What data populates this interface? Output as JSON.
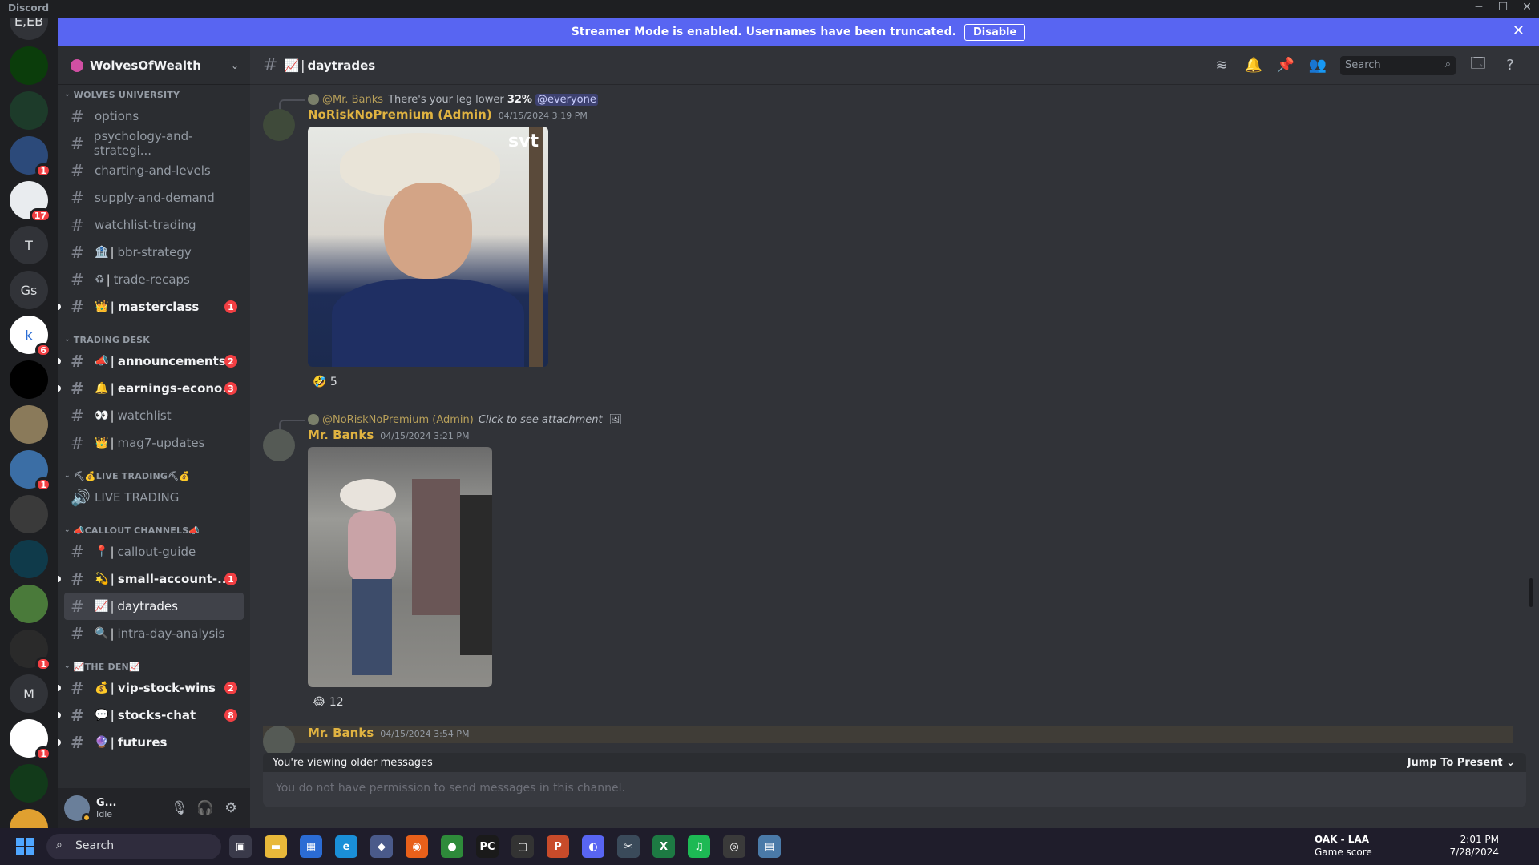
{
  "window": {
    "app_name": "Discord",
    "minimize": "─",
    "maximize": "☐",
    "close": "✕"
  },
  "banner": {
    "text": "Streamer Mode is enabled. Usernames have been truncated.",
    "button": "Disable",
    "close": "✕"
  },
  "servers": [
    {
      "label": "E,EB",
      "color": "#313338",
      "badge": ""
    },
    {
      "label": "",
      "color": "#0b3d0b",
      "badge": ""
    },
    {
      "label": "",
      "color": "#1d3b2a",
      "badge": ""
    },
    {
      "label": "",
      "color": "#2c4a7a",
      "badge": "1"
    },
    {
      "label": "",
      "color": "#e9ecef",
      "badge": "17"
    },
    {
      "label": "T",
      "color": "#313338",
      "badge": ""
    },
    {
      "label": "Gs",
      "color": "#313338",
      "badge": ""
    },
    {
      "label": "k",
      "color": "#ffffff",
      "badge": "6"
    },
    {
      "label": "",
      "color": "#000000",
      "badge": ""
    },
    {
      "label": "",
      "color": "#8a7a5a",
      "badge": ""
    },
    {
      "label": "",
      "color": "#3b6ea5",
      "badge": "1"
    },
    {
      "label": "",
      "color": "#3a3a3a",
      "badge": ""
    },
    {
      "label": "",
      "color": "#0f3a4a",
      "badge": ""
    },
    {
      "label": "",
      "color": "#4a7a3a",
      "badge": ""
    },
    {
      "label": "",
      "color": "#2a2a2a",
      "badge": "1"
    },
    {
      "label": "M",
      "color": "#313338",
      "badge": ""
    },
    {
      "label": "",
      "color": "#ffffff",
      "badge": "1"
    },
    {
      "label": "",
      "color": "#123a1a",
      "badge": ""
    },
    {
      "label": "",
      "color": "#e0a030",
      "badge": ""
    }
  ],
  "server_name": "WolvesOfWealth",
  "categories": [
    {
      "name": "WOLVES UNIVERSITY",
      "channels": [
        {
          "name": "options",
          "emoji": "",
          "unread": false,
          "mention": ""
        },
        {
          "name": "psychology-and-strategi...",
          "emoji": "",
          "unread": false,
          "mention": ""
        },
        {
          "name": "charting-and-levels",
          "emoji": "",
          "unread": false,
          "mention": ""
        },
        {
          "name": "supply-and-demand",
          "emoji": "",
          "unread": false,
          "mention": ""
        },
        {
          "name": "watchlist-trading",
          "emoji": "",
          "unread": false,
          "mention": ""
        },
        {
          "name": "bbr-strategy",
          "emoji": "🏦",
          "unread": false,
          "mention": ""
        },
        {
          "name": "trade-recaps",
          "emoji": "♻",
          "unread": false,
          "mention": ""
        },
        {
          "name": "masterclass",
          "emoji": "👑",
          "unread": true,
          "mention": "1"
        }
      ]
    },
    {
      "name": "TRADING DESK",
      "channels": [
        {
          "name": "announcements",
          "emoji": "📣",
          "unread": true,
          "mention": "2"
        },
        {
          "name": "earnings-econo...",
          "emoji": "🔔",
          "unread": true,
          "mention": "3"
        },
        {
          "name": "watchlist",
          "emoji": "👀",
          "unread": false,
          "mention": ""
        },
        {
          "name": "mag7-updates",
          "emoji": "👑",
          "unread": false,
          "mention": ""
        }
      ]
    },
    {
      "name": "⛏💰LIVE TRADING⛏💰",
      "channels": [
        {
          "name": "LIVE TRADING",
          "emoji": "",
          "unread": false,
          "mention": "",
          "voice": true
        }
      ]
    },
    {
      "name": "📣CALLOUT CHANNELS📣",
      "channels": [
        {
          "name": "callout-guide",
          "emoji": "📍",
          "unread": false,
          "mention": ""
        },
        {
          "name": "small-account-...",
          "emoji": "💫",
          "unread": true,
          "mention": "1"
        },
        {
          "name": "daytrades",
          "emoji": "📈",
          "unread": false,
          "mention": "",
          "selected": true
        },
        {
          "name": "intra-day-analysis",
          "emoji": "🔍",
          "unread": false,
          "mention": ""
        }
      ]
    },
    {
      "name": "📈THE DEN📈",
      "channels": [
        {
          "name": "vip-stock-wins",
          "emoji": "💰",
          "unread": true,
          "mention": "2"
        },
        {
          "name": "stocks-chat",
          "emoji": "💬",
          "unread": true,
          "mention": "8"
        },
        {
          "name": "futures",
          "emoji": "🔮",
          "unread": true,
          "mention": ""
        }
      ]
    }
  ],
  "user": {
    "name": "G...",
    "status": "Idle"
  },
  "chat": {
    "channel": "daytrades",
    "channel_emoji": "📈",
    "search_placeholder": "Search",
    "messages": [
      {
        "reply_name": "@Mr. Banks",
        "reply_text": "There's your leg lower",
        "reply_bold": "32%",
        "reply_mention": "@everyone",
        "author": "NoRiskNoPremium (Admin)",
        "time": "04/15/2024 3:19 PM",
        "image_caption": "svt",
        "reaction_emoji": "🤣",
        "reaction_count": "5"
      },
      {
        "reply_name": "@NoRiskNoPremium (Admin)",
        "reply_text": "Click to see attachment",
        "author": "Mr. Banks",
        "time": "04/15/2024 3:21 PM",
        "reaction_emoji": "😂",
        "reaction_count": "12"
      },
      {
        "author": "Mr. Banks",
        "time": "04/15/2024 3:54 PM"
      }
    ],
    "older_notice": "You're viewing older messages",
    "jump_label": "Jump To Present",
    "composer_placeholder": "You do not have permission to send messages in this channel."
  },
  "taskbar": {
    "search": "Search",
    "game_title": "OAK - LAA",
    "game_sub": "Game score",
    "time": "2:01 PM",
    "date": "7/28/2024"
  }
}
